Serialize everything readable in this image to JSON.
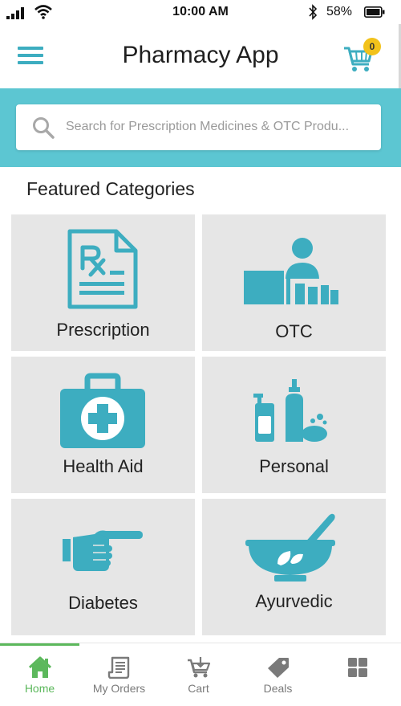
{
  "status_bar": {
    "time": "10:00 AM",
    "battery": "58%"
  },
  "header": {
    "title": "Pharmacy App",
    "cart_count": "0",
    "menu_icon": "hamburger-menu-icon",
    "cart_icon": "cart-icon"
  },
  "search": {
    "placeholder": "Search for Prescription Medicines & OTC Produ..."
  },
  "featured": {
    "title": "Featured Categories",
    "categories": [
      {
        "label": "Prescription",
        "icon": "prescription-icon"
      },
      {
        "label": "OTC",
        "icon": "pharmacist-counter-icon"
      },
      {
        "label": "Health Aid",
        "icon": "first-aid-kit-icon"
      },
      {
        "label": "Personal",
        "icon": "personal-care-bottles-icon"
      },
      {
        "label": "Diabetes",
        "icon": "finger-prick-icon"
      },
      {
        "label": "Ayurvedic",
        "icon": "mortar-pestle-icon"
      }
    ]
  },
  "bottom_nav": {
    "items": [
      {
        "label": "Home",
        "icon": "home-icon",
        "active": true
      },
      {
        "label": "My Orders",
        "icon": "orders-receipt-icon",
        "active": false
      },
      {
        "label": "Cart",
        "icon": "cart-icon",
        "active": false
      },
      {
        "label": "Deals",
        "icon": "tag-icon",
        "active": false
      },
      {
        "label": "",
        "icon": "grid-icon",
        "active": false
      }
    ]
  },
  "colors": {
    "accent": "#5cc6d2",
    "icon": "#3dadc0",
    "tile_bg": "#e6e6e6",
    "active_nav": "#5cb85c",
    "badge": "#f2c21b"
  }
}
